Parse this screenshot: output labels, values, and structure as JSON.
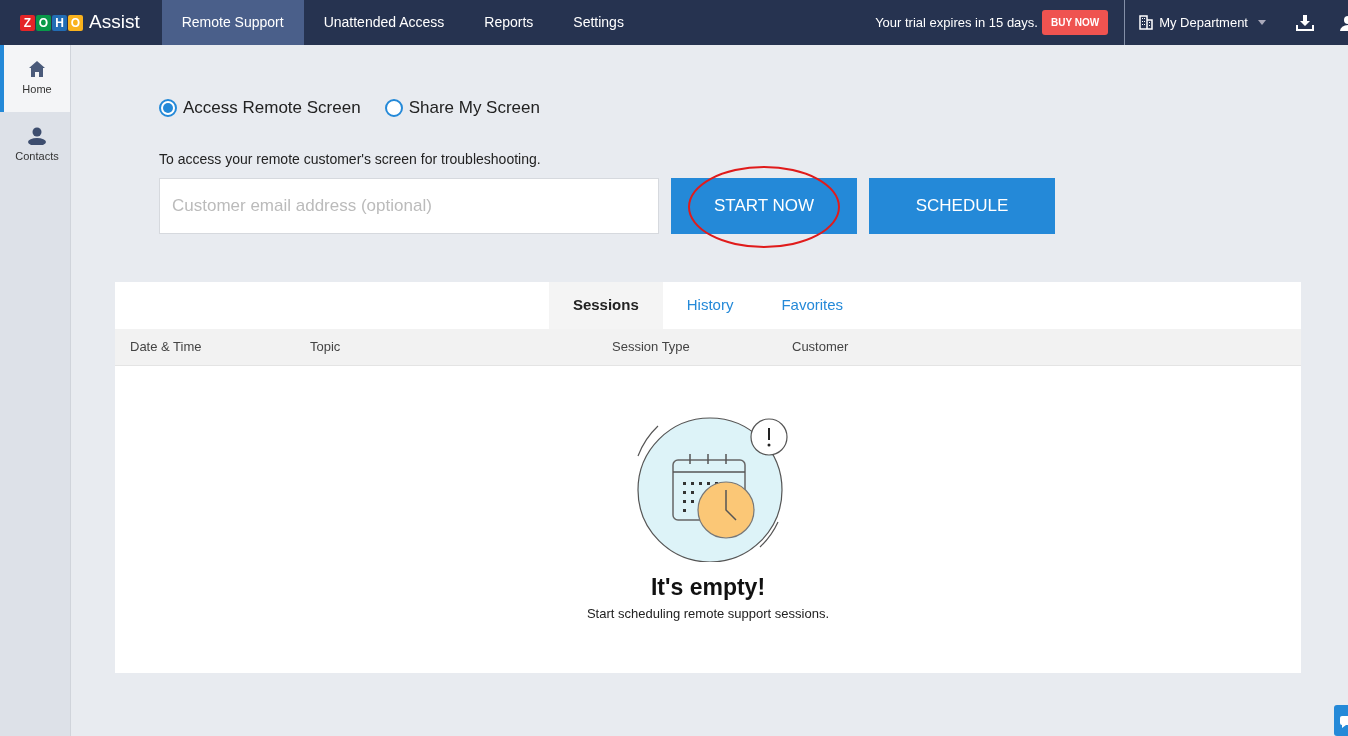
{
  "logo": {
    "letters": [
      {
        "text": "Z",
        "color": "#e42527"
      },
      {
        "text": "O",
        "color": "#089949"
      },
      {
        "text": "H",
        "color": "#226db4"
      },
      {
        "text": "O",
        "color": "#f9b21d"
      }
    ],
    "product": "Assist"
  },
  "nav": [
    {
      "label": "Remote Support",
      "selected": true
    },
    {
      "label": "Unattended Access",
      "selected": false
    },
    {
      "label": "Reports",
      "selected": false
    },
    {
      "label": "Settings",
      "selected": false
    }
  ],
  "trial": {
    "text": "Your trial expires in 15 days.",
    "button": "BUY NOW"
  },
  "department": "My Department",
  "sidebar": [
    {
      "label": "Home",
      "kind": "home",
      "selected": true
    },
    {
      "label": "Contacts",
      "kind": "contacts",
      "selected": false
    }
  ],
  "mode": [
    {
      "label": "Access Remote Screen",
      "selected": true
    },
    {
      "label": "Share My Screen",
      "selected": false
    }
  ],
  "hint": "To access your remote customer's screen for troubleshooting.",
  "email": {
    "placeholder": "Customer email address (optional)"
  },
  "buttons": [
    {
      "label": "START NOW",
      "circled": true
    },
    {
      "label": "SCHEDULE",
      "circled": false
    }
  ],
  "tabs": [
    {
      "label": "Sessions",
      "selected": true
    },
    {
      "label": "History",
      "selected": false
    },
    {
      "label": "Favorites",
      "selected": false
    }
  ],
  "table": {
    "columns": [
      "Date & Time",
      "Topic",
      "Session Type",
      "Customer"
    ]
  },
  "empty": {
    "title": "It's empty!",
    "text": "Start scheduling remote support sessions."
  }
}
